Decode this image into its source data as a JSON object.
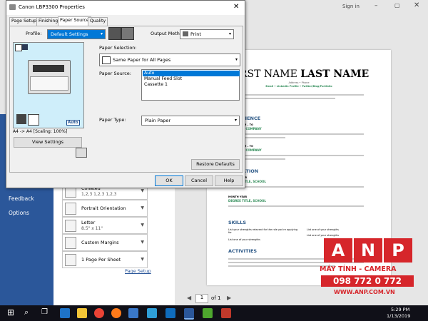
{
  "word": {
    "sign_in": "Sign in",
    "sidebar": [
      "Feedback",
      "Options"
    ],
    "print_options": [
      {
        "t1": "Collated",
        "t2": "1,2,3    1,2,3    1,2,3"
      },
      {
        "t1": "Portrait Orientation",
        "t2": ""
      },
      {
        "t1": "Letter",
        "t2": "8.5\" x 11\""
      },
      {
        "t1": "Custom Margins",
        "t2": ""
      },
      {
        "t1": "1 Page Per Sheet",
        "t2": ""
      }
    ],
    "page_setup_link": "Page Setup",
    "pager": {
      "current": "1",
      "of": "of 1"
    }
  },
  "resume": {
    "name_first": "FIRST NAME",
    "name_last": "LAST NAME",
    "contact1": "Address • Phone",
    "contact2": "Email • LinkedIn Profile • Twitter/Blog/Portfolio",
    "sections": [
      "EXPERIENCE",
      "EDUCATION",
      "SKILLS",
      "ACTIVITIES"
    ],
    "dates1": "DATES FROM – TO",
    "job1": "JOB TITLE, COMPANY",
    "dates2": "DATES FROM – TO",
    "job2": "JOB TITLE, COMPANY",
    "month_year1": "MONTH YEAR",
    "degree1": "DEGREE TITLE, SCHOOL",
    "month_year2": "MONTH YEAR",
    "degree2": "DEGREE TITLE, SCHOOL",
    "skills": [
      "List your strengths relevant for the role you're applying for",
      "List one of your strengths",
      "List one of your strengths",
      "List one of your strengths"
    ]
  },
  "dialog": {
    "title": "Canon LBP3300 Properties",
    "tabs": [
      "Page Setup",
      "Finishing",
      "Paper Source",
      "Quality"
    ],
    "active_tab": 2,
    "profile_label": "Profile:",
    "profile_value": "Default Settings",
    "output_method_label": "Output Method:",
    "output_method_value": "Print",
    "preview_caption": "A4 -> A4 [Scaling: 100%]",
    "auto_badge": "Auto",
    "view_settings": "View Settings",
    "paper_selection_label": "Paper Selection:",
    "paper_selection_value": "Same Paper for All Pages",
    "paper_source_label": "Paper Source:",
    "paper_source_options": [
      "Auto",
      "Manual Feed Slot",
      "Cassette 1"
    ],
    "paper_source_selected": 0,
    "paper_type_label": "Paper Type:",
    "paper_type_value": "Plain Paper",
    "restore_defaults": "Restore Defaults",
    "ok": "OK",
    "cancel": "Cancel",
    "help": "Help"
  },
  "watermark": {
    "letters": [
      "A",
      "N",
      "P"
    ],
    "line1": "MÁY TÍNH - CAMERA",
    "phone": "098 772 0 772",
    "website": "WWW.ANP.COM.VN"
  },
  "taskbar": {
    "time": "5:29 PM",
    "date": "1/13/2019",
    "icons": [
      "windows-start",
      "search",
      "task-view",
      "edge",
      "explorer",
      "chrome",
      "firefox",
      "store",
      "photos",
      "mail",
      "word",
      "paint",
      "app"
    ]
  },
  "colors": {
    "word_blue": "#2b579a",
    "accent": "#0078d7",
    "resume_green": "#2e8b57",
    "watermark_red": "#d6262b"
  }
}
